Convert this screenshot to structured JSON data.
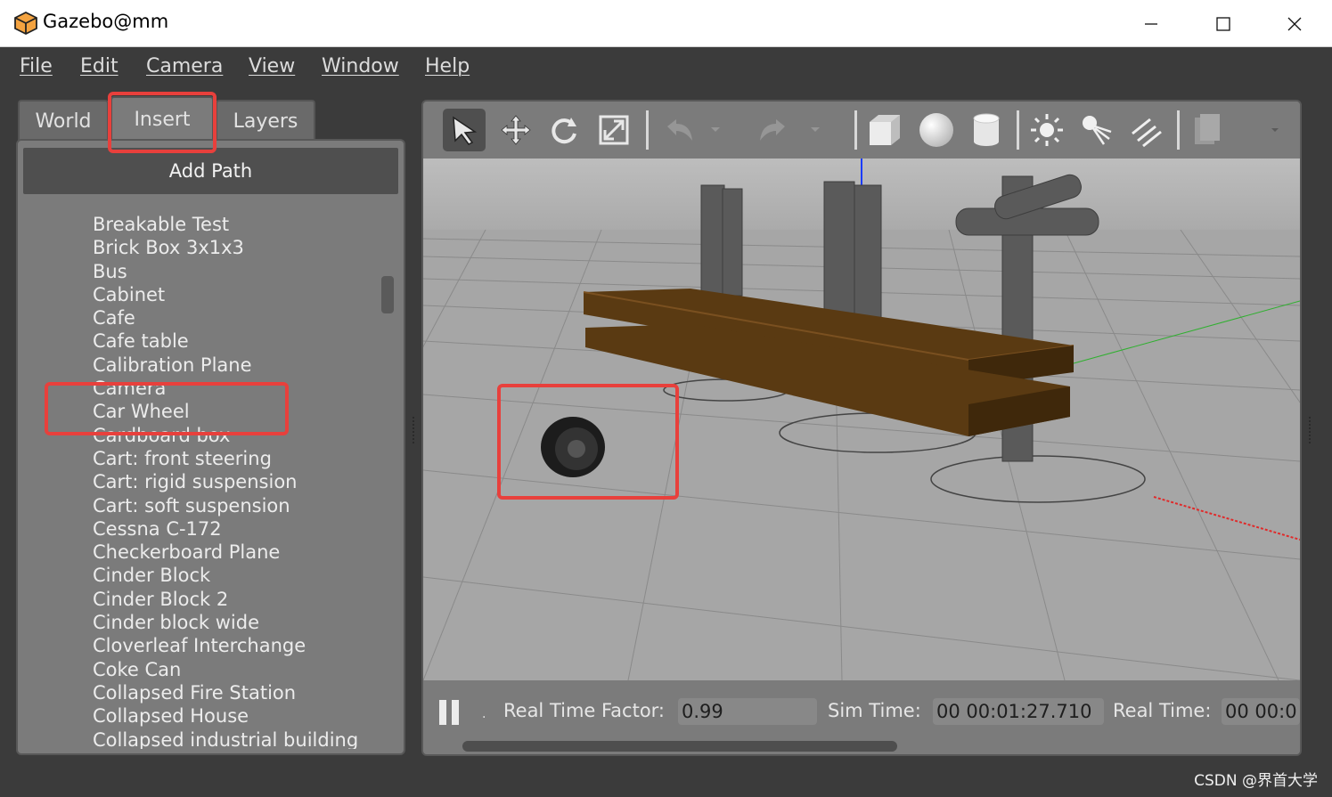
{
  "window": {
    "title": "Gazebo@mm",
    "icon": "gazebo-box-icon",
    "controls": [
      "minimize-icon",
      "maximize-icon",
      "close-icon"
    ]
  },
  "menu": [
    "File",
    "Edit",
    "Camera",
    "View",
    "Window",
    "Help"
  ],
  "left_panel": {
    "tabs": [
      "World",
      "Insert",
      "Layers"
    ],
    "active_tab": "Insert",
    "add_path_label": "Add Path",
    "models": [
      "Breakable Test",
      "Brick Box 3x1x3",
      "Bus",
      "Cabinet",
      "Cafe",
      "Cafe table",
      "Calibration Plane",
      "Camera",
      "Car Wheel",
      "Cardboard box",
      "Cart: front steering",
      "Cart: rigid suspension",
      "Cart: soft suspension",
      "Cessna C-172",
      "Checkerboard Plane",
      "Cinder Block",
      "Cinder Block 2",
      "Cinder block wide",
      "Cloverleaf Interchange",
      "Coke Can",
      "Collapsed Fire Station",
      "Collapsed House",
      "Collapsed industrial building"
    ]
  },
  "toolbar": {
    "tools": [
      "select-arrow-icon",
      "translate-icon",
      "rotate-icon",
      "scale-icon",
      "undo-icon",
      "redo-icon",
      "box-shape-icon",
      "sphere-shape-icon",
      "cylinder-shape-icon",
      "point-light-icon",
      "spot-light-icon",
      "directional-light-icon",
      "copy-icon"
    ]
  },
  "bottom_bar": {
    "pause_icon": "pause-icon",
    "real_time_factor_label": "Real Time Factor:",
    "real_time_factor_value": "0.99",
    "sim_time_label": "Sim Time:",
    "sim_time_value": "00 00:01:27.710",
    "real_time_label": "Real Time:",
    "real_time_value": "00 00:0"
  },
  "watermark": "CSDN @界首大学",
  "colors": {
    "highlight": "#e8403c",
    "panel": "#7b7b7b",
    "viewport": "#a6a6a6",
    "table_wood": "#5a3a12"
  }
}
